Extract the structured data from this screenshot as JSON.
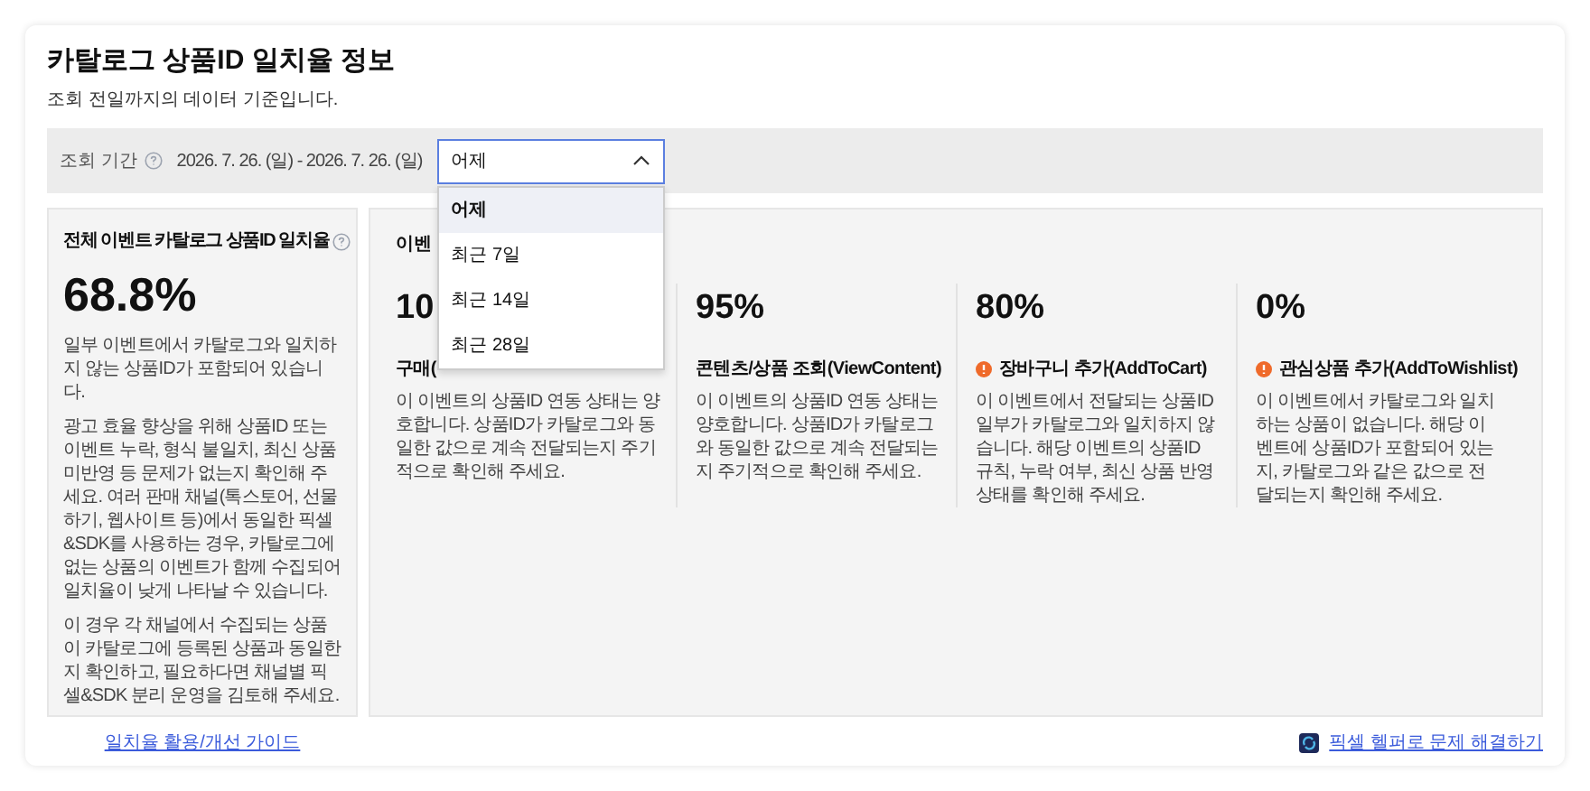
{
  "title": "카탈로그 상품ID 일치율 정보",
  "subtitle": "조회 전일까지의 데이터 기준입니다.",
  "filter": {
    "label": "조회 기간",
    "date_range": "2026. 7. 26. (일) - 2026. 7. 26. (일)",
    "select": {
      "value": "어제",
      "expanded": true,
      "options": [
        {
          "label": "어제",
          "selected": true
        },
        {
          "label": "최근 7일",
          "selected": false
        },
        {
          "label": "최근 14일",
          "selected": false
        },
        {
          "label": "최근 28일",
          "selected": false
        }
      ]
    }
  },
  "overall": {
    "title": "전체 이벤트 카탈로그 상품ID 일치율",
    "value": "68.8%",
    "paragraphs": [
      "일부 이벤트에서 카탈로그와 일치하지 않는 상품ID가 포함되어 있습니다.",
      "광고 효율 향상을 위해 상품ID 또는 이벤트 누락, 형식 불일치, 최신 상품 미반영 등 문제가 없는지 확인해 주세요. 여러 판매 채널(톡스토어, 선물하기, 웹사이트 등)에서 동일한 픽셀&SDK를 사용하는 경우, 카탈로그에 없는 상품의 이벤트가 함께 수집되어 일치율이 낮게 나타날 수 있습니다.",
      "이 경우 각 채널에서 수집되는 상품이 카탈로그에 등록된 상품과 동일한지 확인하고, 필요하다면 채널별 픽셀&SDK 분리 운영을 김토해 주세요."
    ]
  },
  "events_heading": "이벤",
  "events": [
    {
      "value": "10",
      "name": "구매(",
      "warning": false,
      "description": "이 이벤트의 상품ID 연동 상태는 양호합니다. 상품ID가 카탈로그와 동일한 값으로 계속 전달되는지 주기적으로 확인해 주세요."
    },
    {
      "value": "95%",
      "name": "콘텐츠/상품 조회(ViewContent)",
      "warning": false,
      "description": "이 이벤트의 상품ID 연동 상태는 양호합니다. 상품ID가 카탈로그와 동일한 값으로 계속 전달되는지 주기적으로 확인해 주세요."
    },
    {
      "value": "80%",
      "name": "장바구니 추가(AddToCart)",
      "warning": true,
      "description": "이 이벤트에서 전달되는 상품ID 일부가 카탈로그와 일치하지 않습니다. 해당 이벤트의 상품ID 규칙, 누락 여부, 최신 상품 반영 상태를 확인해 주세요."
    },
    {
      "value": "0%",
      "name": "관심상품 추가(AddToWishlist)",
      "warning": true,
      "description": "이 이벤트에서 카탈로그와 일치하는 상품이 없습니다. 해당 이벤트에 상품ID가 포함되어 있는지, 카탈로그와 같은 값으로 전달되는지 확인해 주세요."
    }
  ],
  "guide_link": "일치율 활용/개선 가이드",
  "helper_link": "픽셀 헬퍼로 문제 해결하기"
}
